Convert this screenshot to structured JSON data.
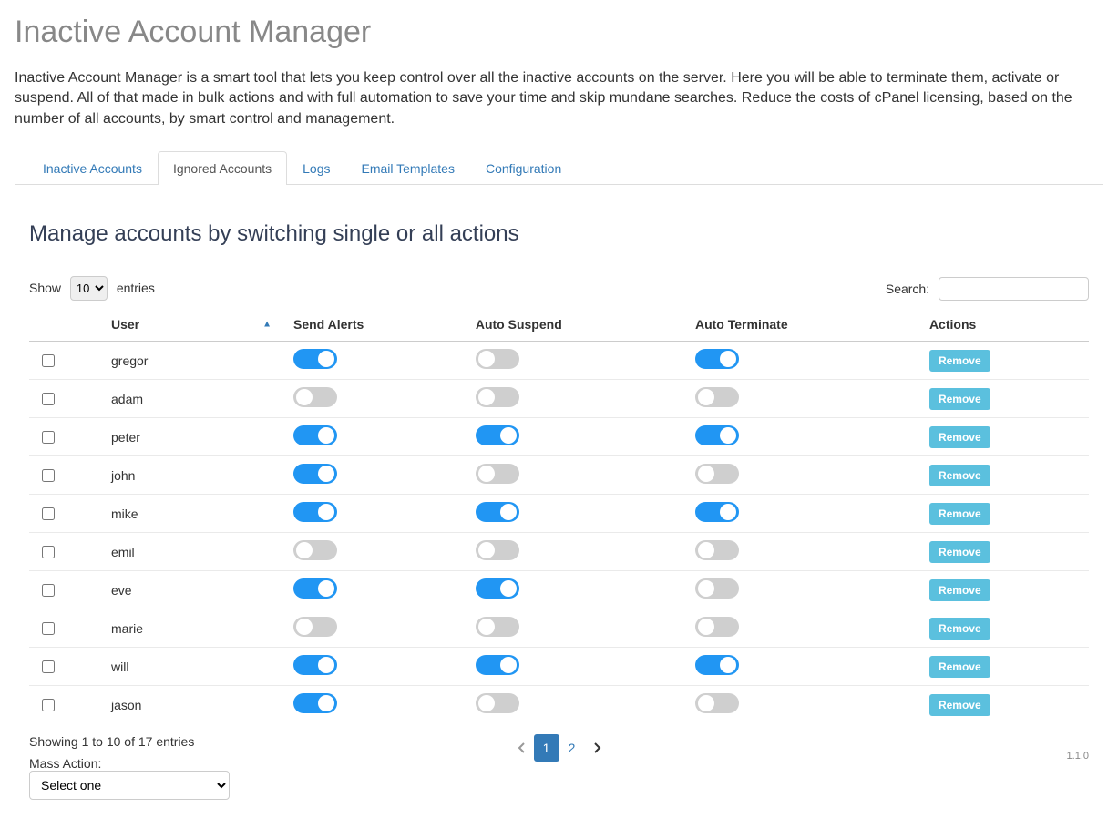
{
  "page": {
    "title": "Inactive Account Manager",
    "description": "Inactive Account Manager is a smart tool that lets you keep control over all the inactive accounts on the server. Here you will be able to terminate them, activate or suspend. All of that made in bulk actions and with full automation to save your time and skip mundane searches. Reduce the costs of cPanel licensing, based on the number of all accounts, by smart control and management."
  },
  "tabs": [
    {
      "label": "Inactive Accounts",
      "active": false
    },
    {
      "label": "Ignored Accounts",
      "active": true
    },
    {
      "label": "Logs",
      "active": false
    },
    {
      "label": "Email Templates",
      "active": false
    },
    {
      "label": "Configuration",
      "active": false
    }
  ],
  "section": {
    "heading": "Manage accounts by switching single or all actions"
  },
  "length_control": {
    "show_label": "Show",
    "entries_label": "entries",
    "value": "10"
  },
  "search": {
    "label": "Search:",
    "value": ""
  },
  "columns": {
    "user": "User",
    "send_alerts": "Send Alerts",
    "auto_suspend": "Auto Suspend",
    "auto_terminate": "Auto Terminate",
    "actions": "Actions"
  },
  "rows": [
    {
      "user": "gregor",
      "send_alerts": true,
      "auto_suspend": false,
      "auto_terminate": true
    },
    {
      "user": "adam",
      "send_alerts": false,
      "auto_suspend": false,
      "auto_terminate": false
    },
    {
      "user": "peter",
      "send_alerts": true,
      "auto_suspend": true,
      "auto_terminate": true
    },
    {
      "user": "john",
      "send_alerts": true,
      "auto_suspend": false,
      "auto_terminate": false
    },
    {
      "user": "mike",
      "send_alerts": true,
      "auto_suspend": true,
      "auto_terminate": true
    },
    {
      "user": "emil",
      "send_alerts": false,
      "auto_suspend": false,
      "auto_terminate": false
    },
    {
      "user": "eve",
      "send_alerts": true,
      "auto_suspend": true,
      "auto_terminate": false
    },
    {
      "user": "marie",
      "send_alerts": false,
      "auto_suspend": false,
      "auto_terminate": false
    },
    {
      "user": "will",
      "send_alerts": true,
      "auto_suspend": true,
      "auto_terminate": true
    },
    {
      "user": "jason",
      "send_alerts": true,
      "auto_suspend": false,
      "auto_terminate": false
    }
  ],
  "buttons": {
    "remove": "Remove"
  },
  "info_text": "Showing 1 to 10 of 17 entries",
  "mass_action": {
    "label": "Mass Action:",
    "placeholder": "Select one"
  },
  "pagination": {
    "current": "1",
    "other": "2"
  },
  "version": "1.1.0"
}
